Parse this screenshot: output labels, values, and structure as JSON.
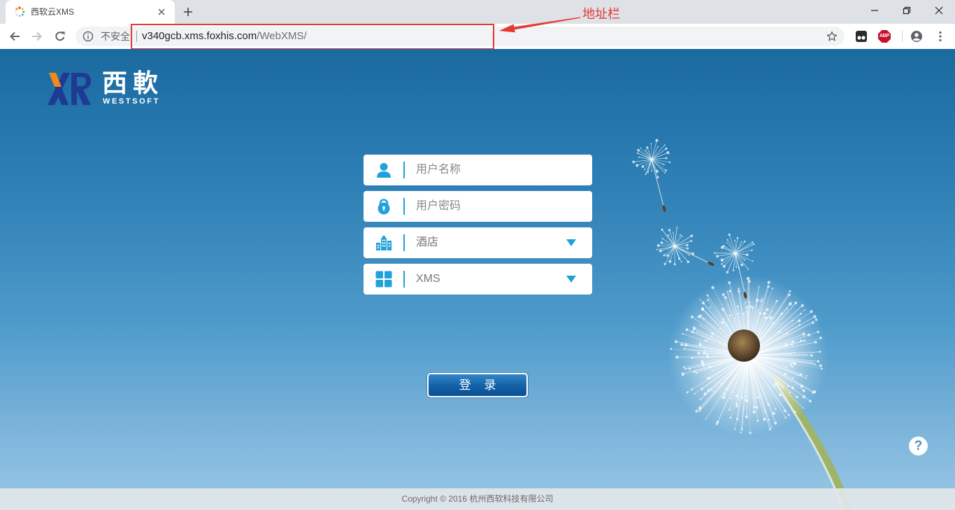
{
  "browser": {
    "tab": {
      "title": "西软云XMS",
      "favicon": "loading-spinner-icon"
    },
    "omnibox": {
      "security_label": "不安全",
      "url_host": "v340gcb.xms.foxhis.com",
      "url_path": "/WebXMS/"
    },
    "extensions": {
      "abp_label": "ABP"
    },
    "icons": [
      "back-icon",
      "forward-icon",
      "reload-icon",
      "info-icon",
      "star-icon",
      "extension-icon",
      "adblock-icon",
      "account-icon",
      "menu-icon",
      "minimize-icon",
      "restore-icon",
      "close-icon",
      "new-tab-icon"
    ]
  },
  "annotation": {
    "label": "地址栏",
    "color": "#e53935"
  },
  "logo": {
    "brand_cn": "西軟",
    "brand_en": "WESTSOFT"
  },
  "login_form": {
    "username": {
      "placeholder": "用户名称",
      "icon": "user-icon"
    },
    "password": {
      "placeholder": "用户密码",
      "icon": "lock-icon"
    },
    "hotel": {
      "selected": "酒店",
      "icon": "building-icon"
    },
    "system": {
      "selected": "XMS",
      "icon": "grid-icon"
    },
    "submit_label": "登 录"
  },
  "help": {
    "label": "?"
  },
  "footer": {
    "copyright": "Copyright © 2016 杭州西软科技有限公司"
  },
  "colors": {
    "accent": "#1ea2da",
    "button": "#0d5498",
    "annotation": "#e53935",
    "background_top": "#1a6aa0",
    "background_bottom": "#9ac8e6"
  }
}
